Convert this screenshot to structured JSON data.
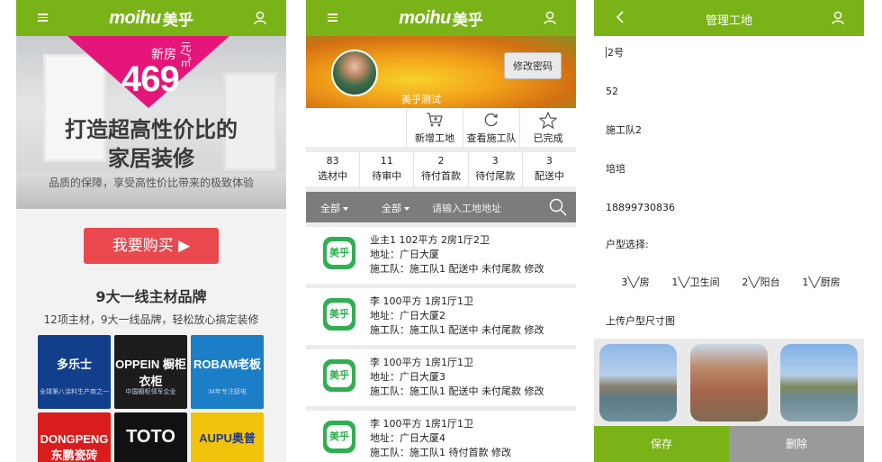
{
  "logo": {
    "word_mo": "moi",
    "word_hu": "hu",
    "cn": "美乎"
  },
  "screen1": {
    "hero": {
      "price_prefix": "新房",
      "price": "469",
      "price_unit": "元/㎡",
      "title_line1": "打造超高性价比的",
      "title_line2": "家居装修",
      "subtitle": "品质的保障，享受高性价比带来的极致体验"
    },
    "buy_button": "我要购买 ▶",
    "brands_title": "9大一线主材品牌",
    "brands_sub": "12项主材，9大一线品牌，轻松放心搞定装修",
    "brands": [
      {
        "name": "多乐士",
        "tag": "全球第八涂料生产商之一"
      },
      {
        "name": "OPPEIN 橱柜 衣柜",
        "tag": "中国橱柜领军企业"
      },
      {
        "name": "ROBAM老板",
        "tag": "34年专注厨电"
      },
      {
        "name": "DONGPENG 东鹏瓷砖",
        "tag": ""
      },
      {
        "name": "TOTO",
        "tag": ""
      },
      {
        "name": "AUPU奥普",
        "tag": ""
      }
    ]
  },
  "screen2": {
    "change_password": "修改密码",
    "nickname": "美乎测试",
    "actions": [
      {
        "label": "新增工地",
        "icon": "cart-icon"
      },
      {
        "label": "查看施工队",
        "icon": "refresh-icon"
      },
      {
        "label": "已完成",
        "icon": "star-icon"
      }
    ],
    "stats": [
      {
        "num": "83",
        "label": "选材中"
      },
      {
        "num": "11",
        "label": "待审中"
      },
      {
        "num": "2",
        "label": "待付首款"
      },
      {
        "num": "3",
        "label": "待付尾款"
      },
      {
        "num": "3",
        "label": "配送中"
      }
    ],
    "filter": {
      "all1": "全部",
      "all2": "全部",
      "placeholder": "请输入工地地址"
    },
    "sites": [
      {
        "line1": "业主1  102平方  2房1厅2卫",
        "line2": "地址：广日大厦",
        "line3": "施工队：施工队1  配送中  未付尾款  修改"
      },
      {
        "line1": "李  100平方  1房1厅1卫",
        "line2": "地址：广日大厦2",
        "line3": "施工队：施工队1  配送中  未付尾款  修改"
      },
      {
        "line1": "李  100平方  1房1厅1卫",
        "line2": "地址：广日大厦3",
        "line3": "施工队：施工队1  配送中  未付尾款  修改"
      },
      {
        "line1": "李  100平方  1房1厅1卫",
        "line2": "地址：广日大厦4",
        "line3": "施工队：施工队1  待付首款  修改"
      }
    ]
  },
  "screen3": {
    "title": "管理工地",
    "fields": [
      "2号",
      "52",
      "施工队2",
      "培培",
      "18899730836"
    ],
    "room_type_label": "户型选择:",
    "rooms": [
      "3╲╱房",
      "1╲╱卫生间",
      "2╲╱阳台",
      "1╲╱厨房"
    ],
    "upload_label": "上传户型尺寸图",
    "save": "保存",
    "delete": "删除"
  }
}
